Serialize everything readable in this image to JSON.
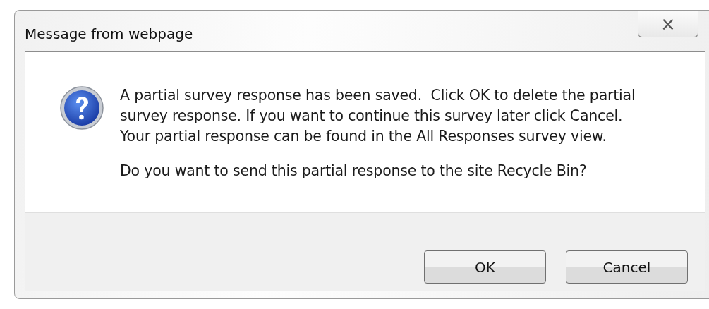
{
  "window": {
    "title": "Message from webpage",
    "close_label": "×"
  },
  "message": {
    "lines": [
      "A partial survey response has been saved.  Click OK to delete the partial",
      "survey response. If you want to continue this survey later click Cancel.",
      "Your partial response can be found in the All Responses survey view."
    ],
    "question": "Do you want to send this partial response to the site Recycle Bin?"
  },
  "buttons": [
    {
      "label": "OK"
    },
    {
      "label": "Cancel"
    }
  ]
}
